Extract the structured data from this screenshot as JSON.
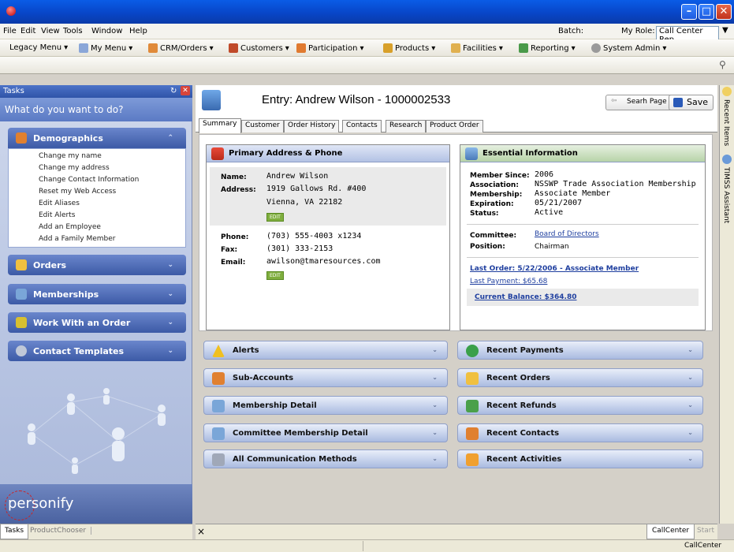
{
  "window": {
    "min": "–",
    "max": "□",
    "close": "✕"
  },
  "menubar": {
    "items": [
      "File",
      "Edit",
      "View",
      "Tools",
      "Window",
      "Help"
    ],
    "batch_label": "Batch:",
    "role_label": "My Role:",
    "role_value": "Call Center Rep"
  },
  "toolbar": {
    "items": [
      "Legacy Menu",
      "My Menu",
      "CRM/Orders",
      "Customers",
      "Participation",
      "Products",
      "Facilities",
      "Reporting",
      "System Admin"
    ]
  },
  "tasks": {
    "title": "Tasks",
    "prompt": "What do you want to do?",
    "groups": [
      "Demographics",
      "Orders",
      "Memberships",
      "Work With an Order",
      "Contact Templates"
    ],
    "demographics_items": [
      "Change my name",
      "Change my address",
      "Change Contact Information",
      "Reset my Web Access",
      "Edit Aliases",
      "Edit Alerts",
      "Add an Employee",
      "Add a Family Member"
    ],
    "brand": "personify",
    "tabs": [
      "Tasks",
      "ProductChooser"
    ]
  },
  "entry": {
    "title": "Entry: Andrew Wilson - 1000002533",
    "search_button": "Searh Page",
    "save_button": "Save"
  },
  "tabs": [
    "Summary",
    "Customer",
    "Order History",
    "Contacts",
    "Research",
    "Product Order"
  ],
  "address": {
    "header": "Primary Address & Phone",
    "name_label": "Name:",
    "name": "Andrew Wilson",
    "address_label": "Address:",
    "address1": "1919 Gallows Rd. #400",
    "address2": "Vienna, VA 22182",
    "edit": "EDIT",
    "phone_label": "Phone:",
    "phone": "(703) 555-4003 x1234",
    "fax_label": "Fax:",
    "fax": "(301) 333-2153",
    "email_label": "Email:",
    "email": "awilson@tmaresources.com"
  },
  "essential": {
    "header": "Essential Information",
    "member_since_label": "Member Since:",
    "member_since": "2006",
    "association_label": "Association:",
    "association": "NSSWP Trade Association Membership",
    "membership_label": "Membership:",
    "membership": "Associate Member",
    "expiration_label": "Expiration:",
    "expiration": "05/21/2007",
    "status_label": "Status:",
    "status": "Active",
    "committee_label": "Committee:",
    "committee": "Board of Directors",
    "position_label": "Position:",
    "position": "Chairman",
    "last_order": "Last Order: 5/22/2006 - Associate Member",
    "last_payment": "Last Payment: $65.68",
    "current_balance": "Current Balance: $364.80"
  },
  "left_bars": [
    "Alerts",
    "Sub-Accounts",
    "Membership Detail",
    "Committee Membership Detail",
    "All Communication Methods"
  ],
  "right_bars": [
    "Recent Payments",
    "Recent Orders",
    "Recent Refunds",
    "Recent Contacts",
    "Recent Activities"
  ],
  "bottom": {
    "close": "×",
    "tab_active": "CallCenter",
    "tab_inactive": "Start"
  },
  "status": {
    "text": "CallCenter"
  },
  "side": {
    "recent": "Recent Items",
    "assistant": "TIMSS Assistant"
  }
}
